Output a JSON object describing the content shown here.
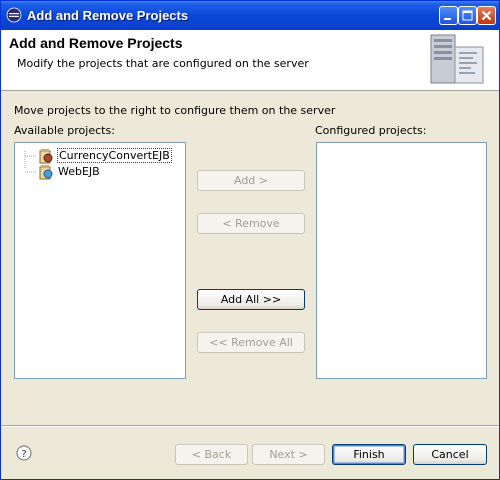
{
  "window": {
    "title": "Add and Remove Projects"
  },
  "header": {
    "title": "Add and Remove Projects",
    "description": "Modify the projects that are configured on the server"
  },
  "main": {
    "instruction": "Move projects to the right to configure them on the server",
    "available_label": "Available projects:",
    "configured_label": "Configured projects:",
    "available_projects": [
      {
        "label": "CurrencyConvertEJB",
        "icon": "ejb-project-icon",
        "selected": true
      },
      {
        "label": "WebEJB",
        "icon": "web-project-icon",
        "selected": false
      }
    ],
    "configured_projects": []
  },
  "actions": {
    "add": "Add >",
    "remove": "< Remove",
    "add_all": "Add All >>",
    "remove_all": "<< Remove All"
  },
  "footer": {
    "back": "< Back",
    "next": "Next >",
    "finish": "Finish",
    "cancel": "Cancel"
  },
  "colors": {
    "titlebar": "#0a47d8",
    "dialog_bg": "#ece9d8",
    "list_border": "#7f9db9",
    "button_border": "#003c74"
  }
}
